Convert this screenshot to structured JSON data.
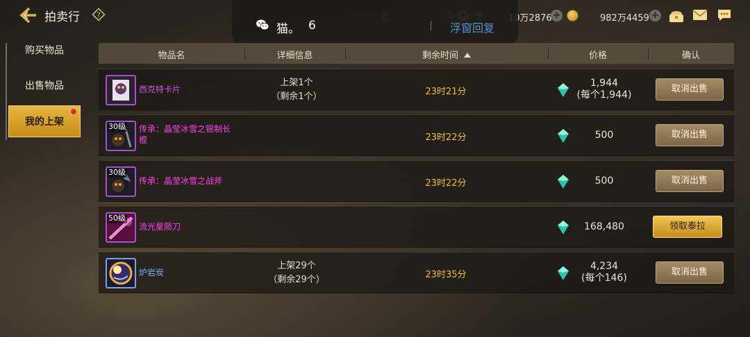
{
  "top": {
    "title": "拍卖行",
    "overlay": {
      "name": "猫。",
      "count": "6",
      "reply": "浮窗回复"
    },
    "currency": {
      "zero": "0",
      "gold_value": "10万2876",
      "gem_value": "982万4459"
    }
  },
  "tabs": [
    {
      "label": "购买物品"
    },
    {
      "label": "出售物品"
    },
    {
      "label": "我的上架",
      "active": true
    }
  ],
  "table": {
    "columns": [
      "物品名",
      "详细信息",
      "剩余时间",
      "价格",
      "确认"
    ],
    "rows": [
      {
        "icon": "card-icon",
        "level": "",
        "name": "西克特卡片",
        "detail_line1": "上架1个",
        "detail_line2": "（剩余1个）",
        "time": "23时21分",
        "price_line1": "1,944",
        "price_line2": "(每个1,944)",
        "action": "取消出售"
      },
      {
        "icon": "staff-icon",
        "level": "30级",
        "name": "传承：晶莹冰雪之银制长棍",
        "detail_line1": "",
        "detail_line2": "",
        "time": "23时22分",
        "price_line1": "500",
        "price_line2": "",
        "action": "取消出售"
      },
      {
        "icon": "axe-icon",
        "level": "30级",
        "name": "传承：晶莹冰雪之战斧",
        "detail_line1": "",
        "detail_line2": "",
        "time": "23时22分",
        "price_line1": "500",
        "price_line2": "",
        "action": "取消出售"
      },
      {
        "icon": "blade-icon",
        "level": "50级",
        "name": "流光星陨刀",
        "detail_line1": "",
        "detail_line2": "",
        "time": "",
        "price_line1": "168,480",
        "price_line2": "",
        "action": "领取泰拉"
      },
      {
        "icon": "lava-stone-icon",
        "level": "",
        "name": "炉岩炭",
        "detail_line1": "上架29个",
        "detail_line2": "（剩余29个）",
        "time": "23时35分",
        "price_line1": "4,234",
        "price_line2": "(每个146)",
        "action": "取消出售"
      }
    ]
  },
  "colors": {
    "accent_gold": "#c78d18",
    "time_text": "#f0be33",
    "rare_purple": "#d24fe8",
    "blue_item": "#6ab2ff",
    "link_blue": "#4e95d4"
  }
}
